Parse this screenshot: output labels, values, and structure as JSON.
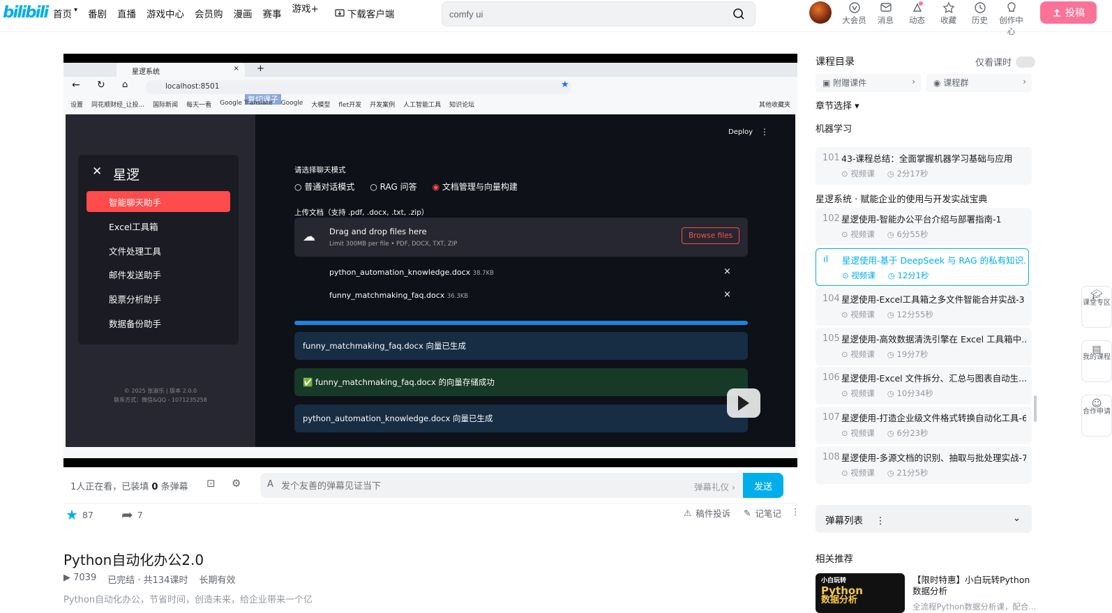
{
  "header": {
    "logo": "bilibili",
    "nav": [
      "首页",
      "番剧",
      "直播",
      "游戏中心",
      "会员购",
      "漫画",
      "赛事",
      "游戏+",
      "下载客户端"
    ],
    "search_value": "comfy ui",
    "icons": [
      {
        "label": "大会员",
        "icon": "vip-icon"
      },
      {
        "label": "消息",
        "icon": "message-icon"
      },
      {
        "label": "动态",
        "icon": "dynamic-icon"
      },
      {
        "label": "收藏",
        "icon": "star-icon"
      },
      {
        "label": "历史",
        "icon": "history-icon"
      },
      {
        "label": "创作中心",
        "icon": "bulb-icon"
      }
    ],
    "upload": "投稿"
  },
  "browser": {
    "tab_title": "星逻系统",
    "url": "localhost:8501",
    "overlay_text": "复切课子",
    "bookmarks": [
      "设置",
      "同花顺财经_让投...",
      "国际新闻",
      "每天一看",
      "Google Translate",
      "Google",
      "大模型",
      "flet开发",
      "开发案例",
      "人工智能工具",
      "知识论坛",
      "其他收藏夹"
    ]
  },
  "app": {
    "deploy": "Deploy",
    "brand": "星逻",
    "menu": [
      "智能聊天助手",
      "Excel工具箱",
      "文件处理工具",
      "邮件发送助手",
      "股票分析助手",
      "数据备份助手"
    ],
    "footer1": "© 2025 张淑乐 | 版本 2.0.0",
    "footer2": "联系方式：微信&QQ - 1071235258",
    "mode_label": "请选择聊天模式",
    "modes": [
      "普通对话模式",
      "RAG 问答",
      "文档管理与向量构建"
    ],
    "upload_label": "上传文档（支持 .pdf, .docx, .txt, .zip）",
    "drop_title": "Drag and drop files here",
    "drop_limit": "Limit 300MB per file • PDF, DOCX, TXT, ZIP",
    "browse": "Browse files",
    "files": [
      {
        "name": "python_automation_knowledge.docx",
        "size": "38.7KB"
      },
      {
        "name": "funny_matchmaking_faq.docx",
        "size": "36.3KB"
      }
    ],
    "msg1": "funny_matchmaking_faq.docx 向量已生成",
    "msg2": "funny_matchmaking_faq.docx 的向量存储成功",
    "msg3": "python_automation_knowledge.docx 向量已生成"
  },
  "controls": {
    "watching_prefix": "1人正在看，已装填",
    "watching_count": "0",
    "watching_suffix": "条弹幕",
    "danmaku_placeholder": "发个友善的弹幕见证当下",
    "etiquette": "弹幕礼仪 ›",
    "send": "发送"
  },
  "actions": {
    "likes": "87",
    "shares": "7",
    "report": "稿件投诉",
    "note": "记笔记"
  },
  "video": {
    "title": "Python自动化办公2.0",
    "views": "7039",
    "status": "已完结 · 共134课时",
    "validity": "长期有效",
    "desc": "Python自动化办公，节省时间，创造未来，给企业带来一个亿"
  },
  "sidebar": {
    "catalog": "课程目录",
    "only_lessons": "仅看课时",
    "attachment": "附赠课件",
    "group": "课程群",
    "chapter": "章节选择",
    "section1": "机器学习",
    "section2": "星逻系统 · 赋能企业的使用与开发实战宝典",
    "lessons": [
      {
        "num": "101",
        "title": "43-课程总结：全面掌握机器学习基础与应用",
        "type": "视频课",
        "dur": "2分17秒",
        "active": false
      },
      {
        "num": "102",
        "title": "星逻使用-智能办公平台介绍与部署指南-1",
        "type": "视频课",
        "dur": "6分55秒",
        "active": false
      },
      {
        "num": "103",
        "title": "星逻使用-基于 DeepSeek 与 RAG 的私有知识...",
        "type": "视频课",
        "dur": "12分1秒",
        "active": true
      },
      {
        "num": "104",
        "title": "星逻使用-Excel工具箱之多文件智能合并实战-3",
        "type": "视频课",
        "dur": "12分55秒",
        "active": false
      },
      {
        "num": "105",
        "title": "星逻使用-高效数据清洗引擎在 Excel 工具箱中...",
        "type": "视频课",
        "dur": "19分7秒",
        "active": false
      },
      {
        "num": "106",
        "title": "星逻使用-Excel 文件拆分、汇总与图表自动生...",
        "type": "视频课",
        "dur": "10分34秒",
        "active": false
      },
      {
        "num": "107",
        "title": "星逻使用-打造企业级文件格式转换自动化工具-6",
        "type": "视频课",
        "dur": "6分23秒",
        "active": false
      },
      {
        "num": "108",
        "title": "星逻使用-多源文档的识别、抽取与批处理实战-7",
        "type": "视频课",
        "dur": "21分5秒",
        "active": false
      }
    ],
    "danmaku_list": "弹幕列表",
    "related": "相关推荐",
    "rec_title": "【限时特惠】小白玩转Python数据分析",
    "rec_sub": "全流程Python数据分析课，配合...",
    "rec_thumb_line1": "小白玩转",
    "rec_thumb_line2": "Python",
    "rec_thumb_line3": "数据分析"
  },
  "float": [
    {
      "label": "课堂专区",
      "icon": "classroom-icon"
    },
    {
      "label": "我的课程",
      "icon": "course-icon"
    },
    {
      "label": "合作申请",
      "icon": "cooperate-icon"
    }
  ]
}
